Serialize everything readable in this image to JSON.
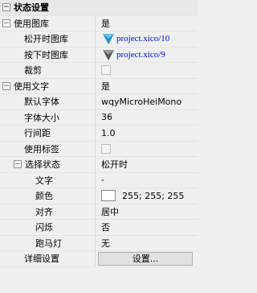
{
  "section": {
    "title": "状态设置",
    "toggle": "−"
  },
  "rows": {
    "use_image": {
      "name": "使用图库",
      "value": "是",
      "toggle": "−"
    },
    "normal_image": {
      "name": "松开时图库",
      "value": "project.xico/10"
    },
    "pressed_image": {
      "name": "按下时图库",
      "value": "project.xico/9"
    },
    "crop": {
      "name": "裁剪"
    },
    "use_text": {
      "name": "使用文字",
      "value": "是",
      "toggle": "−"
    },
    "default_font": {
      "name": "默认字体",
      "value": "wqyMicroHeiMono"
    },
    "font_size": {
      "name": "字体大小",
      "value": "36"
    },
    "line_spacing": {
      "name": "行间距",
      "value": "1.0"
    },
    "use_label": {
      "name": "使用标签"
    },
    "select_state": {
      "name": "选择状态",
      "value": "松开时",
      "toggle": "−"
    },
    "text": {
      "name": "文字",
      "value": "-"
    },
    "color": {
      "name": "颜色",
      "value": "255; 255; 255",
      "swatch": "#ffffff"
    },
    "align": {
      "name": "对齐",
      "value": "居中"
    },
    "blink": {
      "name": "闪烁",
      "value": "否"
    },
    "marquee": {
      "name": "跑马灯",
      "value": "无"
    },
    "detail": {
      "name": "详细设置",
      "button": "设置..."
    }
  },
  "icon_colors": {
    "normal": "#1e90c8",
    "pressed": "#555555"
  }
}
